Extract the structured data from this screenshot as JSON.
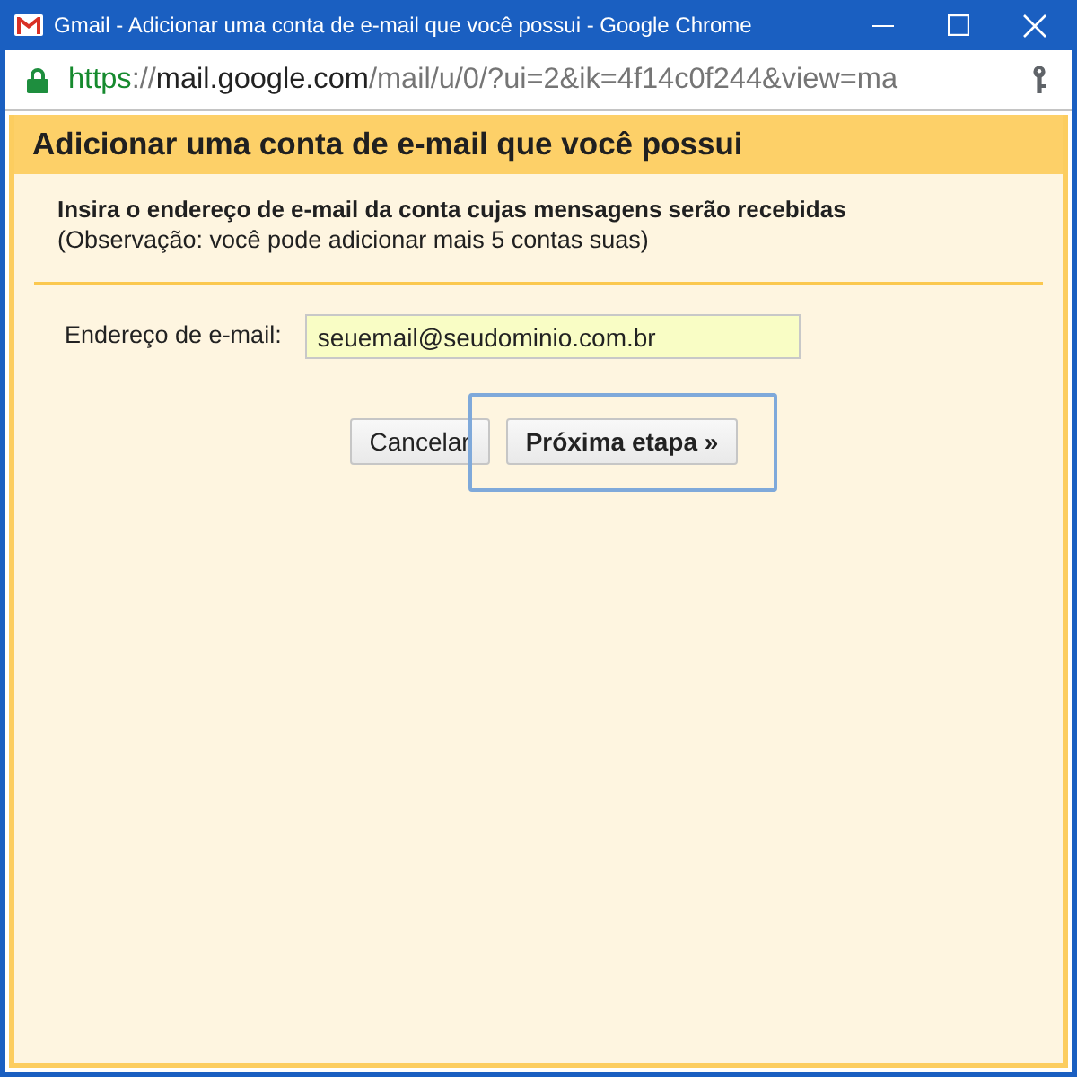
{
  "window": {
    "title": "Gmail - Adicionar uma conta de e-mail que você possui - Google Chrome"
  },
  "address_bar": {
    "secure": true,
    "url": [
      {
        "kind": "scheme",
        "text": "https"
      },
      {
        "kind": "separator",
        "text": "://"
      },
      {
        "kind": "host",
        "text": "mail.google.com"
      },
      {
        "kind": "path",
        "text": "/mail/u/0/?ui=2&ik=4f14c0f244&view=ma"
      }
    ]
  },
  "dialog": {
    "title": "Adicionar uma conta de e-mail que você possui",
    "instruction": "Insira o endereço de e-mail da conta cujas mensagens serão recebidas",
    "note": "(Observação: você pode adicionar mais 5 contas suas)",
    "fields": [
      {
        "label": "Endereço de e-mail:",
        "value": "seuemail@seudominio.com.br"
      }
    ],
    "buttons": [
      {
        "label": "Cancelar",
        "primary": false,
        "highlighted": false
      },
      {
        "label": "Próxima etapa »",
        "primary": true,
        "highlighted": true
      }
    ]
  }
}
